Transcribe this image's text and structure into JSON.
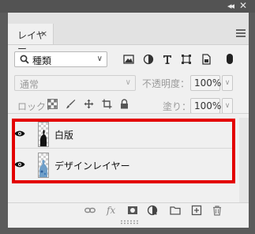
{
  "window": {
    "collapse_icon": "double-chevron-left-icon",
    "close_icon": "close-icon"
  },
  "panel": {
    "tab_label": "レイヤー",
    "tab_close": "×",
    "menu_icon": "hamburger-menu-icon"
  },
  "filter": {
    "kind_label": "種類",
    "icons": [
      "image-filter-icon",
      "adjustment-filter-icon",
      "type-filter-icon",
      "shape-filter-icon",
      "smart-object-filter-icon"
    ]
  },
  "blend": {
    "mode": "通常",
    "opacity_label": "不透明度：",
    "opacity_value": "100%"
  },
  "lock": {
    "label": "ロック：",
    "icons": [
      "lock-transparent-pixels-icon",
      "lock-image-pixels-icon",
      "lock-position-icon",
      "lock-artboard-icon",
      "lock-all-icon"
    ],
    "fill_label": "塗り：",
    "fill_value": "100%"
  },
  "layers": [
    {
      "name": "白版",
      "visible": true
    },
    {
      "name": "デザインレイヤー",
      "visible": true
    }
  ],
  "highlight_color": "#e30000",
  "bottom_icons": [
    "link-layers-icon",
    "fx-icon",
    "add-mask-icon",
    "adjustment-layer-icon",
    "new-group-icon",
    "new-layer-icon",
    "trash-icon"
  ]
}
